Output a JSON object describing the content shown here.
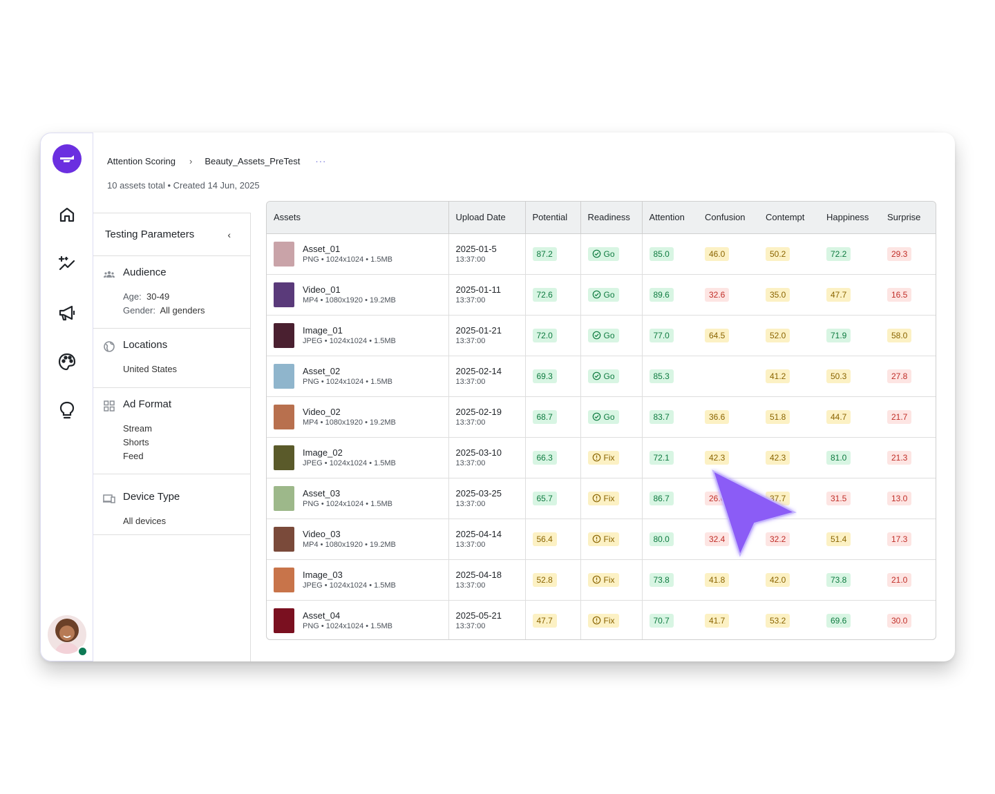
{
  "colors": {
    "brand": "#6b2fe0",
    "good": "#0d7a3f",
    "warn": "#8a6400",
    "bad": "#c02d27"
  },
  "rail": {
    "logo": "brand-logo",
    "items": [
      "home-icon",
      "sparkle-chart-icon",
      "megaphone-icon",
      "palette-icon",
      "lightbulb-icon"
    ],
    "status": "online"
  },
  "header": {
    "crumb_1": "Attention Scoring",
    "crumb_sep": "›",
    "crumb_2": "Beauty_Assets_PreTest",
    "more": "···",
    "subtitle": "10 assets total • Created 14 Jun, 2025"
  },
  "params": {
    "title": "Testing Parameters",
    "collapse": "‹",
    "audience": {
      "title": "Audience",
      "age_label": "Age:",
      "age_value": "30-49",
      "gender_label": "Gender:",
      "gender_value": "All genders"
    },
    "locations": {
      "title": "Locations",
      "value": "United States"
    },
    "ad_format": {
      "title": "Ad Format",
      "values": [
        "Stream",
        "Shorts",
        "Feed"
      ]
    },
    "device": {
      "title": "Device Type",
      "value": "All devices"
    }
  },
  "table": {
    "columns": [
      "Assets",
      "Upload Date",
      "Potential",
      "Readiness",
      "Attention",
      "Confusion",
      "Contempt",
      "Happiness",
      "Surprise"
    ],
    "rows": [
      {
        "name": "Asset_01",
        "meta": "PNG • 1024x1024 • 1.5MB",
        "date": "2025-01-5",
        "time": "13:37:00",
        "potential": "87.2",
        "readiness": "Go",
        "attention": "85.0",
        "confusion": "46.0",
        "contempt": "50.2",
        "happiness": "72.2",
        "surprise": "29.3",
        "thumb": "#c9a3a8"
      },
      {
        "name": "Video_01",
        "meta": "MP4 • 1080x1920 • 19.2MB",
        "date": "2025-01-11",
        "time": "13:37:00",
        "potential": "72.6",
        "readiness": "Go",
        "attention": "89.6",
        "confusion": "32.6",
        "contempt": "35.0",
        "happiness": "47.7",
        "surprise": "16.5",
        "thumb": "#5a3a7a"
      },
      {
        "name": "Image_01",
        "meta": "JPEG • 1024x1024 • 1.5MB",
        "date": "2025-01-21",
        "time": "13:37:00",
        "potential": "72.0",
        "readiness": "Go",
        "attention": "77.0",
        "confusion": "64.5",
        "contempt": "52.0",
        "happiness": "71.9",
        "surprise": "58.0",
        "thumb": "#4a2030"
      },
      {
        "name": "Asset_02",
        "meta": "PNG • 1024x1024 • 1.5MB",
        "date": "2025-02-14",
        "time": "13:37:00",
        "potential": "69.3",
        "readiness": "Go",
        "attention": "85.3",
        "confusion": "",
        "contempt": "41.2",
        "happiness": "50.3",
        "surprise": "27.8",
        "thumb": "#8fb5cc"
      },
      {
        "name": "Video_02",
        "meta": "MP4 • 1080x1920 • 19.2MB",
        "date": "2025-02-19",
        "time": "13:37:00",
        "potential": "68.7",
        "readiness": "Go",
        "attention": "83.7",
        "confusion": "36.6",
        "contempt": "51.8",
        "happiness": "44.7",
        "surprise": "21.7",
        "thumb": "#b8704e"
      },
      {
        "name": "Image_02",
        "meta": "JPEG • 1024x1024 • 1.5MB",
        "date": "2025-03-10",
        "time": "13:37:00",
        "potential": "66.3",
        "readiness": "Fix",
        "attention": "72.1",
        "confusion": "42.3",
        "contempt": "42.3",
        "happiness": "81.0",
        "surprise": "21.3",
        "thumb": "#5a5a2a"
      },
      {
        "name": "Asset_03",
        "meta": "PNG • 1024x1024 • 1.5MB",
        "date": "2025-03-25",
        "time": "13:37:00",
        "potential": "65.7",
        "readiness": "Fix",
        "attention": "86.7",
        "confusion": "26.6",
        "contempt": "37.7",
        "happiness": "31.5",
        "surprise": "13.0",
        "thumb": "#9db88a"
      },
      {
        "name": "Video_03",
        "meta": "MP4 • 1080x1920 • 19.2MB",
        "date": "2025-04-14",
        "time": "13:37:00",
        "potential": "56.4",
        "readiness": "Fix",
        "attention": "80.0",
        "confusion": "32.4",
        "contempt": "32.2",
        "happiness": "51.4",
        "surprise": "17.3",
        "thumb": "#7a4a3a"
      },
      {
        "name": "Image_03",
        "meta": "JPEG • 1024x1024 • 1.5MB",
        "date": "2025-04-18",
        "time": "13:37:00",
        "potential": "52.8",
        "readiness": "Fix",
        "attention": "73.8",
        "confusion": "41.8",
        "contempt": "42.0",
        "happiness": "73.8",
        "surprise": "21.0",
        "thumb": "#c8744a"
      },
      {
        "name": "Asset_04",
        "meta": "PNG • 1024x1024 • 1.5MB",
        "date": "2025-05-21",
        "time": "13:37:00",
        "potential": "47.7",
        "readiness": "Fix",
        "attention": "70.7",
        "confusion": "41.7",
        "contempt": "53.2",
        "happiness": "69.6",
        "surprise": "30.0",
        "thumb": "#7a1020"
      }
    ]
  },
  "overlay": {
    "pointer": "pointer-cursor-icon",
    "pointer_color": "#8b5cf6"
  }
}
